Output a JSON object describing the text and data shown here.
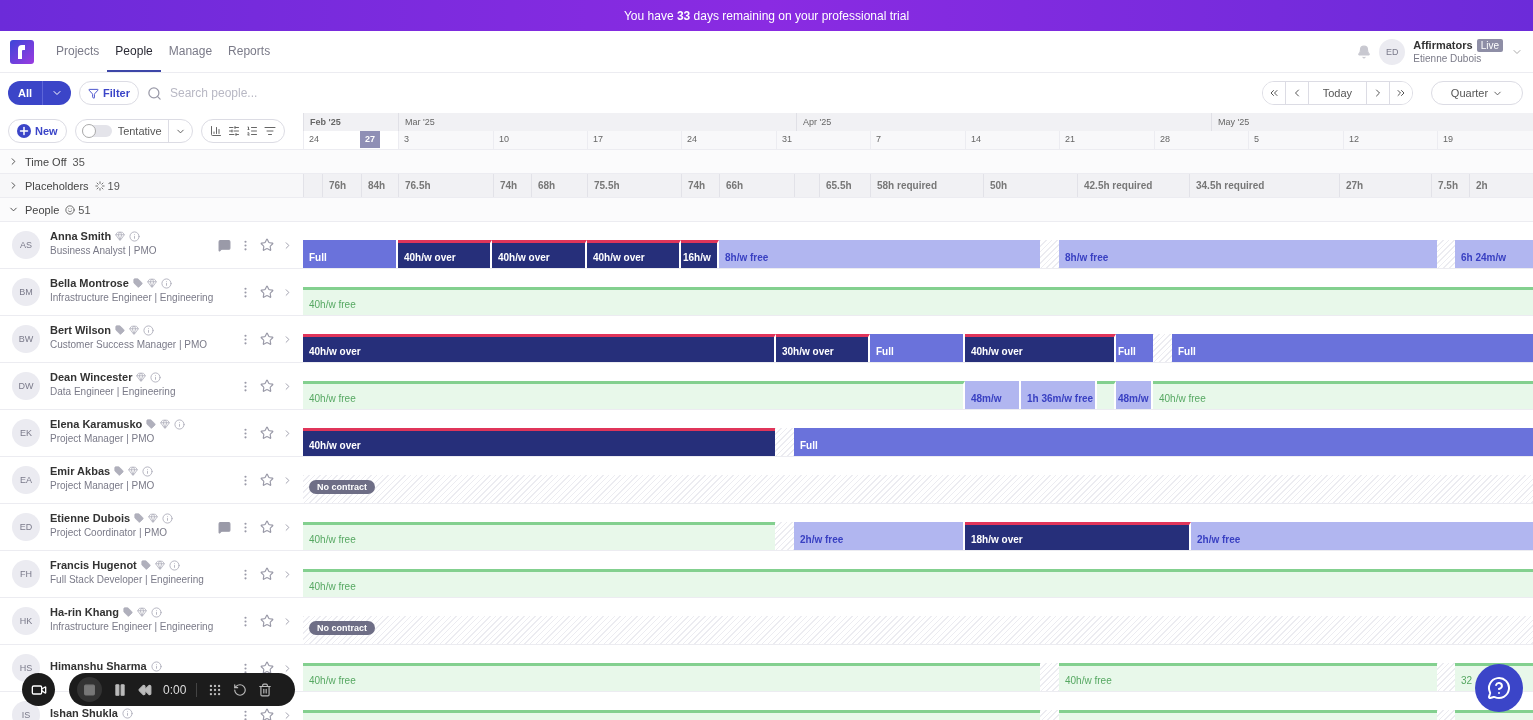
{
  "banner": "You have **33** days remaining on your professional trial",
  "nav": [
    {
      "label": "Projects",
      "selected": false
    },
    {
      "label": "People",
      "selected": true
    },
    {
      "label": "Manage",
      "selected": false
    },
    {
      "label": "Reports",
      "selected": false
    }
  ],
  "account": {
    "initials": "ED",
    "org": "Affirmators",
    "badge": "Live",
    "user": "Etienne Dubois"
  },
  "toolbar": {
    "all": "All",
    "filter": "Filter",
    "search_placeholder": "Search people...",
    "today": "Today",
    "period": "Quarter"
  },
  "controls": {
    "new": "New",
    "tentative": "Tentative",
    "tentative_on": false
  },
  "months": [
    "Feb '25",
    "Mar '25",
    "Apr '25",
    "May '25"
  ],
  "days": [
    {
      "label": "24",
      "selected": false
    },
    {
      "label": "27",
      "selected": true
    },
    {
      "label": "3",
      "selected": false
    },
    {
      "label": "10",
      "selected": false
    },
    {
      "label": "17",
      "selected": false
    },
    {
      "label": "24",
      "selected": false
    },
    {
      "label": "31",
      "selected": false
    },
    {
      "label": "7",
      "selected": false
    },
    {
      "label": "14",
      "selected": false
    },
    {
      "label": "21",
      "selected": false
    },
    {
      "label": "28",
      "selected": false
    },
    {
      "label": "5",
      "selected": false
    },
    {
      "label": "12",
      "selected": false
    },
    {
      "label": "19",
      "selected": false
    }
  ],
  "groups": [
    {
      "label": "Time Off",
      "count": "35",
      "expanded": false,
      "kind": "plain"
    },
    {
      "label": "Placeholders",
      "count": "19",
      "expanded": false,
      "kind": "placeholder"
    },
    {
      "label": "People",
      "count": "51",
      "expanded": true,
      "kind": "person"
    }
  ],
  "placeholder_hours": [
    {
      "kind": "empty"
    },
    {
      "kind": "hours",
      "label": "76h"
    },
    {
      "kind": "hours",
      "label": "84h"
    },
    {
      "kind": "hours",
      "label": "76.5h"
    },
    {
      "kind": "hours",
      "label": "74h"
    },
    {
      "kind": "hours",
      "label": "68h"
    },
    {
      "kind": "hours",
      "label": "75.5h"
    },
    {
      "kind": "hours",
      "label": "74h"
    },
    {
      "kind": "hours",
      "label": "66h"
    },
    {
      "kind": "empty"
    },
    {
      "kind": "hours",
      "label": "65.5h"
    },
    {
      "kind": "hours",
      "label": "58h required"
    },
    {
      "kind": "hours",
      "label": "50h"
    },
    {
      "kind": "hours",
      "label": "42.5h required"
    },
    {
      "kind": "hours",
      "label": "34.5h required"
    },
    {
      "kind": "hours",
      "label": "27h"
    },
    {
      "kind": "hours",
      "label": "7.5h"
    },
    {
      "kind": "hours",
      "label": "2h"
    }
  ],
  "people": [
    {
      "initials": "AS",
      "name": "Anna Smith",
      "role": "Business Analyst | PMO",
      "tag": false,
      "gem": true,
      "comment": true,
      "bars": [
        {
          "kind": "full",
          "label": "Full"
        },
        {
          "kind": "over",
          "label": "40h/w over"
        },
        {
          "kind": "over",
          "label": "40h/w over"
        },
        {
          "kind": "over",
          "label": "40h/w over"
        },
        {
          "kind": "over",
          "label": "16h/w"
        },
        {
          "kind": "partial",
          "label": "8h/w free"
        },
        {
          "kind": "gap"
        },
        {
          "kind": "partial",
          "label": "8h/w free"
        },
        {
          "kind": "gap"
        },
        {
          "kind": "partial",
          "label": "6h 24m/w"
        }
      ]
    },
    {
      "initials": "BM",
      "name": "Bella Montrose",
      "role": "Infrastructure Engineer | Engineering",
      "tag": true,
      "gem": true,
      "comment": false,
      "bars": [
        {
          "kind": "free",
          "label": "40h/w free"
        }
      ]
    },
    {
      "initials": "BW",
      "name": "Bert Wilson",
      "role": "Customer Success Manager | PMO",
      "tag": true,
      "gem": true,
      "comment": false,
      "bars": [
        {
          "kind": "over",
          "label": "40h/w over"
        },
        {
          "kind": "over",
          "label": "30h/w over"
        },
        {
          "kind": "full",
          "label": "Full"
        },
        {
          "kind": "over",
          "label": "40h/w over"
        },
        {
          "kind": "full",
          "label": "Full"
        },
        {
          "kind": "gap"
        },
        {
          "kind": "full",
          "label": "Full"
        }
      ]
    },
    {
      "initials": "DW",
      "name": "Dean Wincester",
      "role": "Data Engineer | Engineering",
      "tag": false,
      "gem": true,
      "comment": false,
      "bars": [
        {
          "kind": "free",
          "label": "40h/w free"
        },
        {
          "kind": "partial",
          "label": "48m/w"
        },
        {
          "kind": "partial",
          "label": "1h 36m/w free"
        },
        {
          "kind": "free"
        },
        {
          "kind": "partial",
          "label": "48m/w"
        },
        {
          "kind": "free",
          "label": "40h/w free"
        }
      ]
    },
    {
      "initials": "EK",
      "name": "Elena Karamusko",
      "role": "Project Manager | PMO",
      "tag": true,
      "gem": true,
      "comment": false,
      "bars": [
        {
          "kind": "over",
          "label": "40h/w over"
        },
        {
          "kind": "gap"
        },
        {
          "kind": "full",
          "label": "Full"
        }
      ]
    },
    {
      "initials": "EA",
      "name": "Emir Akbas",
      "role": "Project Manager | PMO",
      "tag": true,
      "gem": true,
      "comment": false,
      "bars": [
        {
          "kind": "nocontract",
          "label": "No contract"
        }
      ]
    },
    {
      "initials": "ED",
      "name": "Etienne Dubois",
      "role": "Project Coordinator | PMO",
      "tag": true,
      "gem": true,
      "comment": true,
      "bars": [
        {
          "kind": "free",
          "label": "40h/w free"
        },
        {
          "kind": "gap"
        },
        {
          "kind": "partial",
          "label": "2h/w free"
        },
        {
          "kind": "over",
          "label": "18h/w over"
        },
        {
          "kind": "partial",
          "label": "2h/w free"
        }
      ]
    },
    {
      "initials": "FH",
      "name": "Francis Hugenot",
      "role": "Full Stack Developer | Engineering",
      "tag": true,
      "gem": true,
      "comment": false,
      "bars": [
        {
          "kind": "free",
          "label": "40h/w free"
        }
      ]
    },
    {
      "initials": "HK",
      "name": "Ha-rin Khang",
      "role": "Infrastructure Engineer | Engineering",
      "tag": true,
      "gem": true,
      "comment": false,
      "bars": [
        {
          "kind": "nocontract",
          "label": "No contract"
        }
      ]
    },
    {
      "initials": "HS",
      "name": "Himanshu Sharma",
      "tag": false,
      "gem": false,
      "comment": false,
      "bars": [
        {
          "kind": "free",
          "label": "40h/w free"
        },
        {
          "kind": "gap"
        },
        {
          "kind": "free",
          "label": "40h/w free"
        },
        {
          "kind": "gap"
        },
        {
          "kind": "free",
          "label": "32"
        }
      ]
    },
    {
      "initials": "IS",
      "name": "Ishan Shukla",
      "tag": false,
      "gem": false,
      "comment": false,
      "bars": [
        {
          "kind": "free"
        },
        {
          "kind": "gap"
        },
        {
          "kind": "free"
        },
        {
          "kind": "gap"
        },
        {
          "kind": "free"
        }
      ]
    }
  ],
  "recorder": {
    "time": "0:00"
  }
}
